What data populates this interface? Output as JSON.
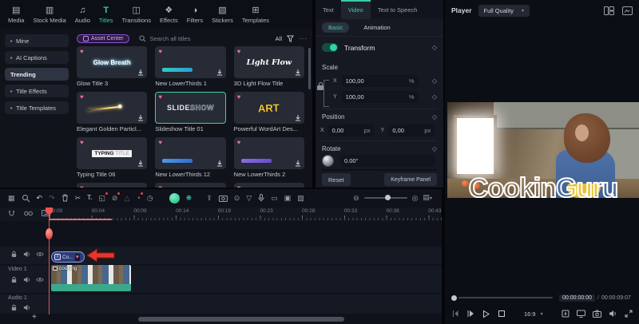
{
  "colors": {
    "accent": "#35cda8",
    "heart_pink": "#ef6a9e",
    "annotation_red": "#e5372b",
    "clip_teal": "#3aa98b",
    "text_clip_border": "#8ca0ea",
    "asset_badge_purple": "#8d4fd2"
  },
  "icons": {
    "media": "▤",
    "stock_media": "▥",
    "audio": "♫",
    "titles": "T",
    "transitions": "◫",
    "effects": "❖",
    "filters": "◑",
    "stickers": "▧",
    "templates": "⊞",
    "chevron": "▸",
    "heart": "♥",
    "diamond": "◇",
    "caret_down": "▾",
    "more": "···",
    "plus": "+",
    "grid_view": "▦",
    "undo": "↶",
    "redo": "↷",
    "split": "✂",
    "text_tool": "T.",
    "crop": "◱",
    "unlink": "⊘",
    "mask": "△",
    "speed": "◔",
    "timer": "◷",
    "effects_flower": "❋",
    "export": "⇪",
    "record": "⊙",
    "shield": "▽",
    "panel": "▭",
    "screen_record": "▣",
    "image": "▨",
    "zoom_out": "⊖",
    "fit": "◎",
    "track_manager": "▤",
    "step_back": "◁",
    "step_forward": "I▷",
    "play": "▷",
    "stop": "▢"
  },
  "toolbar": {
    "items": [
      {
        "label": "Media"
      },
      {
        "label": "Stock Media"
      },
      {
        "label": "Audio"
      },
      {
        "label": "Titles",
        "active": true
      },
      {
        "label": "Transitions"
      },
      {
        "label": "Effects"
      },
      {
        "label": "Filters"
      },
      {
        "label": "Stickers"
      },
      {
        "label": "Templates"
      }
    ]
  },
  "sidebar": {
    "items": [
      {
        "label": "Mine"
      },
      {
        "label": "AI Captions"
      },
      {
        "label": "Trending",
        "selected": true
      },
      {
        "label": "Title Effects"
      },
      {
        "label": "Title Templates"
      }
    ]
  },
  "titles": {
    "asset_center_label": "Asset Center",
    "search_placeholder": "Search all titles",
    "filter_all_label": "All",
    "items": [
      {
        "name": "Glow Title 3",
        "preview": "Glow Breath"
      },
      {
        "name": "New LowerThirds 1"
      },
      {
        "name": "3D Light Flow Title",
        "preview": "Light Flow"
      },
      {
        "name": "Elegant Golden Particl..."
      },
      {
        "name": "Slideshow Title 01",
        "preview_solid": "SLIDE",
        "preview_outline": "SHOW",
        "selected": true
      },
      {
        "name": "Powerful WordArt Des...",
        "preview": "ART"
      },
      {
        "name": "Typing Title 06",
        "preview_bold": "TYPING",
        "preview_rest": " TITLE"
      },
      {
        "name": "New LowerThirds 12"
      },
      {
        "name": "New LowerThirds 2"
      }
    ]
  },
  "properties": {
    "tabs": [
      {
        "label": "Text"
      },
      {
        "label": "Video",
        "active": true
      },
      {
        "label": "Text to Speech"
      }
    ],
    "subtabs": [
      {
        "label": "Basic",
        "active": true
      },
      {
        "label": "Animation"
      }
    ],
    "transform_label": "Transform",
    "scale_label": "Scale",
    "scale_x_label": "X",
    "scale_x": "100,00",
    "scale_y_label": "Y",
    "scale_y": "100,00",
    "scale_unit": "%",
    "position_label": "Position",
    "pos_x_label": "X",
    "pos_x": "0,00",
    "pos_y_label": "Y",
    "pos_y": "0,00",
    "pos_unit": "px",
    "rotate_label": "Rotate",
    "rotate_value": "0.00°",
    "reset_label": "Reset",
    "keyframe_panel_label": "Keyframe Panel"
  },
  "player": {
    "label": "Player",
    "quality": "Full Quality",
    "overlay_text": "CookinGuru",
    "time_current": "00:00:00:00",
    "time_separator": "/",
    "time_total": "00:00:09:07",
    "aspect_ratio": "16:9"
  },
  "timeline": {
    "ruler_labels": [
      "00:00",
      "00:04",
      "00:09",
      "00:14",
      "00:19",
      "00:23",
      "00:28",
      "00:33",
      "00:38",
      "00:43"
    ],
    "text_clip_label": "Co...",
    "video_clip_label": "cooking",
    "video_track_label": "Video 1",
    "audio_track_label": "Audio 1"
  }
}
